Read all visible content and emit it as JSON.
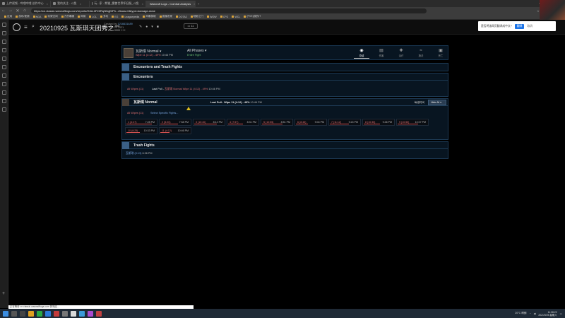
{
  "browser": {
    "tabs": [
      {
        "label": "上传视频 - 哔哩哔哩 创作中心",
        "active": false
      },
      {
        "label": "我的关注 - 斗鱼",
        "active": false
      },
      {
        "label": "玩...家 - 熊猫_魔兽世界怀旧服_斗鱼",
        "active": false
      },
      {
        "label": "Warcraft Logs - Combat Analysis",
        "active": true
      }
    ],
    "url": "https://cn.classic.warcraftlogs.com/reports/H4kLhF2ZRqN3qjKfPh...#boss=0&type=damage-done",
    "user_label": "· 北风澳洲",
    "bookmarks": [
      "应用",
      "游戏/视频",
      "NGA",
      "玩家空间",
      "方的暴躁",
      "网易",
      "LOL",
      "多玩",
      "EG",
      "Leaguepedia",
      "风暴英雄",
      "直播发现",
      "DOTA2",
      "暗影之门",
      "WOW",
      "CFG",
      "WCL",
      "(PVE)我的IT"
    ]
  },
  "site": {
    "report_title": "20210925 瓦斯琪天团秀之二...",
    "created_by_label": "Created by",
    "created_by_user": "1216631489",
    "created_date": "Sat Sep 25 2021",
    "comment_count": "11"
  },
  "popup": {
    "message": "是否将该网页翻译成中文?",
    "translate": "翻译",
    "cancel": "取消"
  },
  "filter": {
    "boss": "瓦斯琪 Normal",
    "boss_sub_red": "Wipe 11 (4:12) - 49%",
    "boss_sub_time": "10:46 PM",
    "phase": "All Phases",
    "phase_sub": "Entire Fight",
    "view_tabs": [
      {
        "label": "总结",
        "icon": "eye-icon",
        "active": true
      },
      {
        "label": "伤害",
        "icon": "chart-icon",
        "active": false
      },
      {
        "label": "治疗",
        "icon": "heal-icon",
        "active": false
      },
      {
        "label": "施法",
        "icon": "cast-icon",
        "active": false
      },
      {
        "label": "死亡",
        "icon": "death-icon",
        "active": false
      }
    ]
  },
  "panels": {
    "encounters_and_trash": "Encounters and Trash Fights",
    "encounters": "Encounters",
    "all_wipes": "All Wipes (11)",
    "last_pull_label": "Last Pull -",
    "last_pull_boss": "瓦斯琪 Normal Wipe 11 (4:12) - 49%",
    "last_pull_time": "10:46 PM",
    "boss_title": "瓦斯琪 Normal",
    "boss_last_pull": "Last Pull - Wipe 11 (4:12) - 49%",
    "boss_last_pull_time": "10:46 PM",
    "sort_label": "每组时间",
    "hide_all": "Hide All",
    "boss_all_wipes": "All Wipes (11)",
    "select_fights": "Select Specific Fights...",
    "fights": [
      {
        "label": "1 (4:47)",
        "time": "7:28 PM",
        "pct": 0.85
      },
      {
        "label": "2 (5:20)",
        "time": "7:58 PM",
        "pct": 0.6
      },
      {
        "label": "3 (10:40)",
        "time": "8:12 PM",
        "pct": 0.75
      },
      {
        "label": "4 (7:57)",
        "time": "8:31 PM",
        "pct": 0.5
      },
      {
        "label": "5 (10:55)",
        "time": "8:51 PM",
        "pct": 0.7
      },
      {
        "label": "6 (8:45)",
        "time": "9:04 PM",
        "pct": 0.4
      },
      {
        "label": "7 (11:12)",
        "time": "9:24 PM",
        "pct": 0.65
      },
      {
        "label": "8 (10:35)",
        "time": "9:46 PM",
        "pct": 0.55
      },
      {
        "label": "9 (10:55)",
        "time": "10:07 PM",
        "pct": 0.7
      },
      {
        "label": "10 (8:25)",
        "time": "10:33 PM",
        "pct": 0.45
      },
      {
        "label": "11 (4:12)",
        "time": "10:46 PM",
        "pct": 0.3
      }
    ],
    "trash_fights": "Trash Fights",
    "trash_item": "瓦斯琪 (0:13)",
    "trash_time": "6:36 PM"
  },
  "statusbar": {
    "link": "正在等待 cn.classic.warcraftlogs.com 的响应..."
  },
  "taskbar": {
    "weather": "20°C 晴朗",
    "time": "11:08:22",
    "date": "2021/9/25 星期六"
  }
}
